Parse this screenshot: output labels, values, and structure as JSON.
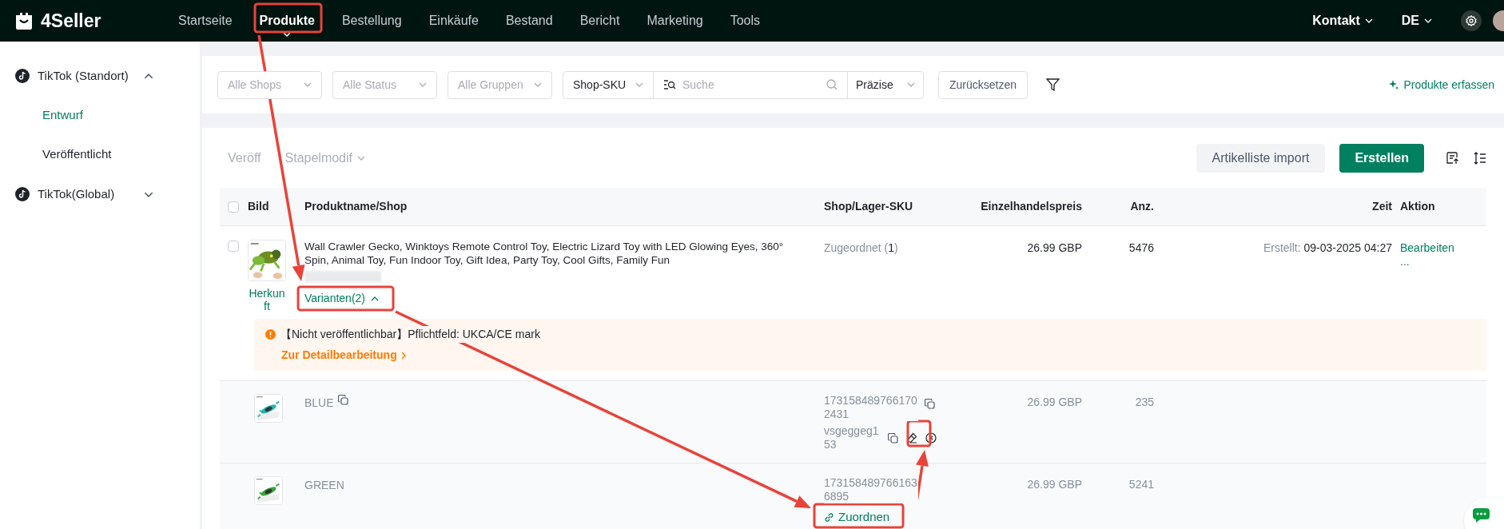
{
  "brand": "4Seller",
  "nav": [
    {
      "label": "Startseite",
      "selected": false
    },
    {
      "label": "Produkte",
      "selected": true
    },
    {
      "label": "Bestellung",
      "selected": false
    },
    {
      "label": "Einkäufe",
      "selected": false
    },
    {
      "label": "Bestand",
      "selected": false
    },
    {
      "label": "Bericht",
      "selected": false
    },
    {
      "label": "Marketing",
      "selected": false
    },
    {
      "label": "Tools",
      "selected": false
    }
  ],
  "header_right": {
    "contact": "Kontakt",
    "language": "DE"
  },
  "sidebar": {
    "groups": [
      {
        "label": "TikTok (Standort)",
        "expanded": true,
        "children": [
          {
            "label": "Entwurf",
            "selected": true
          },
          {
            "label": "Veröffentlicht",
            "selected": false
          }
        ]
      },
      {
        "label": "TikTok(Global)",
        "expanded": false
      }
    ]
  },
  "filters": {
    "selects": [
      {
        "placeholder": "Alle Shops"
      },
      {
        "placeholder": "Alle Status"
      },
      {
        "placeholder": "Alle Gruppen"
      }
    ],
    "search_type": "Shop-SKU",
    "search_placeholder": "Suche",
    "match": "Präzise",
    "reset": "Zurücksetzen",
    "capture": "Produkte erfassen"
  },
  "toolbar": {
    "bulk": [
      {
        "label": "Veröff",
        "kind": "button",
        "disabled": true
      },
      {
        "label": "Stapelmodif",
        "kind": "dropdown",
        "disabled": true
      }
    ],
    "import": "Artikelliste import",
    "create": "Erstellen"
  },
  "table": {
    "select_all_checked": false,
    "columns": [
      "Bild",
      "Produktname/Shop",
      "Shop/Lager-SKU",
      "Einzelhandelspreis",
      "Anz.",
      "Zeit",
      "Aktion"
    ],
    "products": [
      {
        "checked": false,
        "title": "Wall Crawler Gecko, Winktoys Remote Control Toy, Electric Lizard Toy with LED Glowing Eyes, 360° Spin, Animal Toy, Fun Indoor Toy, Gift Idea, Party Toy, Cool Gifts, Family Fun",
        "origin": "Herkunft",
        "variants_toggle": "Varianten(2)",
        "expanded": true,
        "mapping": "Zugeordnet (",
        "mapping_count": "1",
        "mapping_end": ")",
        "price": "26.99 GBP",
        "qty": "5476",
        "created_label": "Erstellt:",
        "created": "09-03-2025 04:27",
        "actions": [
          "Bearbeiten",
          "..."
        ],
        "warning": {
          "text": "【Nicht veröffentlichbar】Pflichtfeld: UKCA/CE mark",
          "link": "Zur Detailbearbeitung"
        },
        "variants": [
          {
            "name": "BLUE",
            "sku": "1731584897661702431",
            "kind": "mapped",
            "warehouse_sku": "vsgeggeg153",
            "price": "26.99 GBP",
            "qty": "235"
          },
          {
            "name": "GREEN",
            "sku": "1731584897661636895",
            "kind": "unmapped",
            "map_link": "Zuordnen",
            "price": "26.99 GBP",
            "qty": "5241"
          }
        ]
      }
    ]
  }
}
